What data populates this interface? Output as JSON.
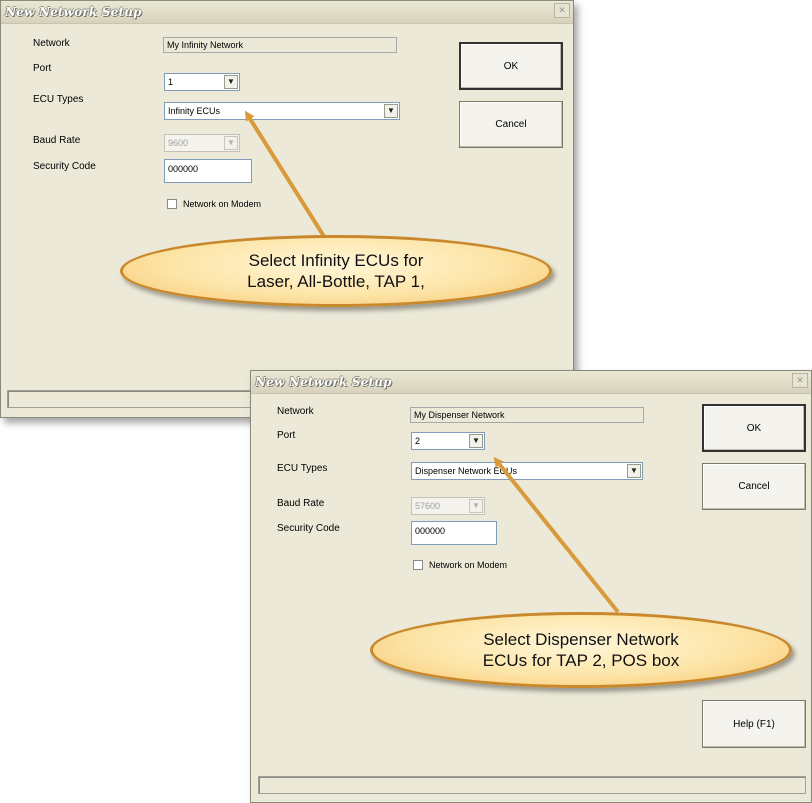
{
  "dialog1": {
    "title": "New Network Setup",
    "labels": {
      "network": "Network",
      "port": "Port",
      "ecu_types": "ECU Types",
      "baud_rate": "Baud Rate",
      "security_code": "Security Code"
    },
    "network_value": "My Infinity Network",
    "port_value": "1",
    "ecu_types_value": "Infinity ECUs",
    "baud_rate_value": "9600",
    "security_code_value": "000000",
    "network_on_modem_label": "Network on Modem",
    "ok_label": "OK",
    "cancel_label": "Cancel",
    "callout_line1": "Select Infinity ECUs for",
    "callout_line2": "Laser, All-Bottle, TAP 1,"
  },
  "dialog2": {
    "title": "New Network Setup",
    "labels": {
      "network": "Network",
      "port": "Port",
      "ecu_types": "ECU Types",
      "baud_rate": "Baud Rate",
      "security_code": "Security Code"
    },
    "network_value": "My Dispenser Network",
    "port_value": "2",
    "ecu_types_value": "Dispenser Network ECUs",
    "baud_rate_value": "57600",
    "security_code_value": "000000",
    "network_on_modem_label": "Network on Modem",
    "ok_label": "OK",
    "cancel_label": "Cancel",
    "help_label": "Help (F1)",
    "callout_line1": "Select Dispenser Network",
    "callout_line2": "ECUs for TAP 2, POS box"
  },
  "icons": {
    "close": "close-icon",
    "dropdown": "chevron-down-icon"
  },
  "colors": {
    "callout_fill": "#fde5a8",
    "callout_border": "#c9882c",
    "arrow": "#d99a3c",
    "dialog_bg": "#ece9d8"
  }
}
